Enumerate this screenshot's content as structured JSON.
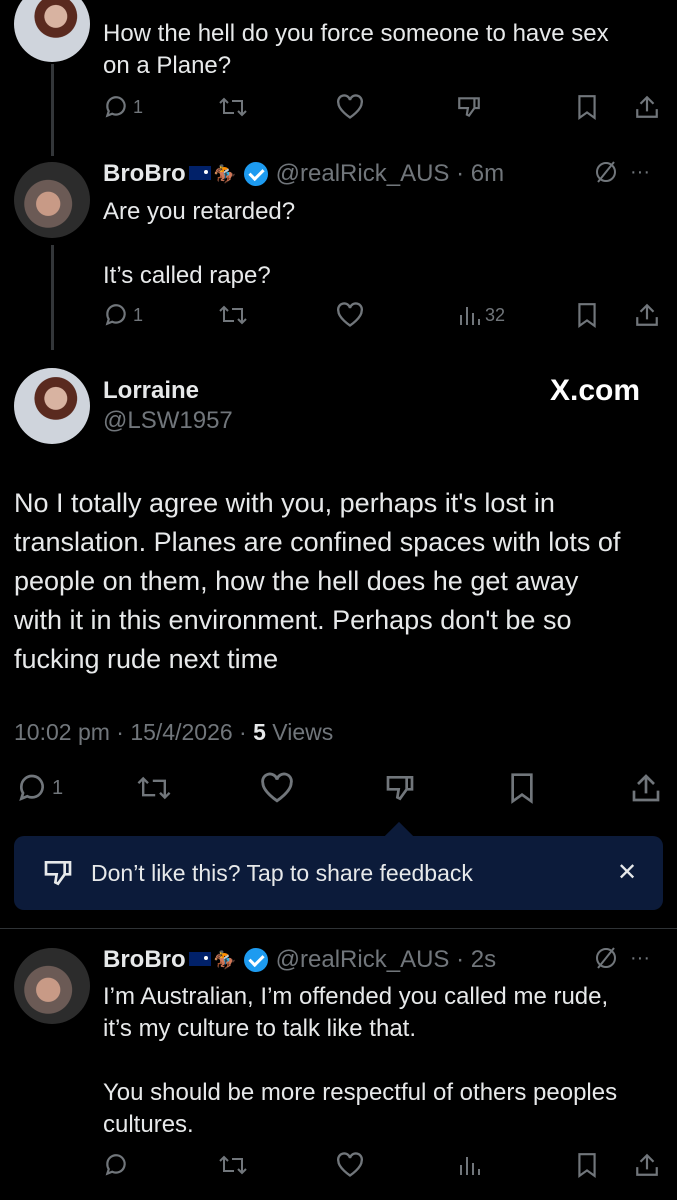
{
  "tweet1": {
    "text_line1": "How the hell do you force someone to have sex",
    "text_line2": "on a Plane?",
    "reply_count": "1"
  },
  "tweet2": {
    "name": "BroBro",
    "handle_time": "@realRick_AUS · 6m",
    "line1": "Are you retarded?",
    "line2": "It’s called rape?",
    "reply_count": "1",
    "views_count": "32"
  },
  "main": {
    "name": "Lorraine",
    "handle": "@LSW1957",
    "watermark": "X.com",
    "text_lines": [
      "No I totally agree with you, perhaps it's lost in",
      "translation. Planes are confined spaces with lots of",
      "people on them, how the hell does he get away",
      "with it in this environment. Perhaps don't be so",
      "fucking rude next time"
    ],
    "timestamp": "10:02 pm · 15/4/2026 · ",
    "views_number": "5",
    "views_label": " Views",
    "reply_count": "1"
  },
  "feedback": {
    "text": "Don’t like this? Tap to share feedback",
    "close": "✕"
  },
  "tweet3": {
    "name": "BroBro",
    "handle_time": "@realRick_AUS · 2s",
    "line1": "I’m Australian, I’m offended you called me rude,",
    "line2": "it’s my culture to talk like that.",
    "line3": "You should be more respectful of others peoples",
    "line4": "cultures."
  },
  "icons": {
    "more": "···",
    "grok": "grok-icon"
  },
  "colors": {
    "background": "#000000",
    "text": "#e7e9ea",
    "muted": "#71767b",
    "verified": "#1d9bf0",
    "feedback_bg": "#0c1b3a"
  }
}
